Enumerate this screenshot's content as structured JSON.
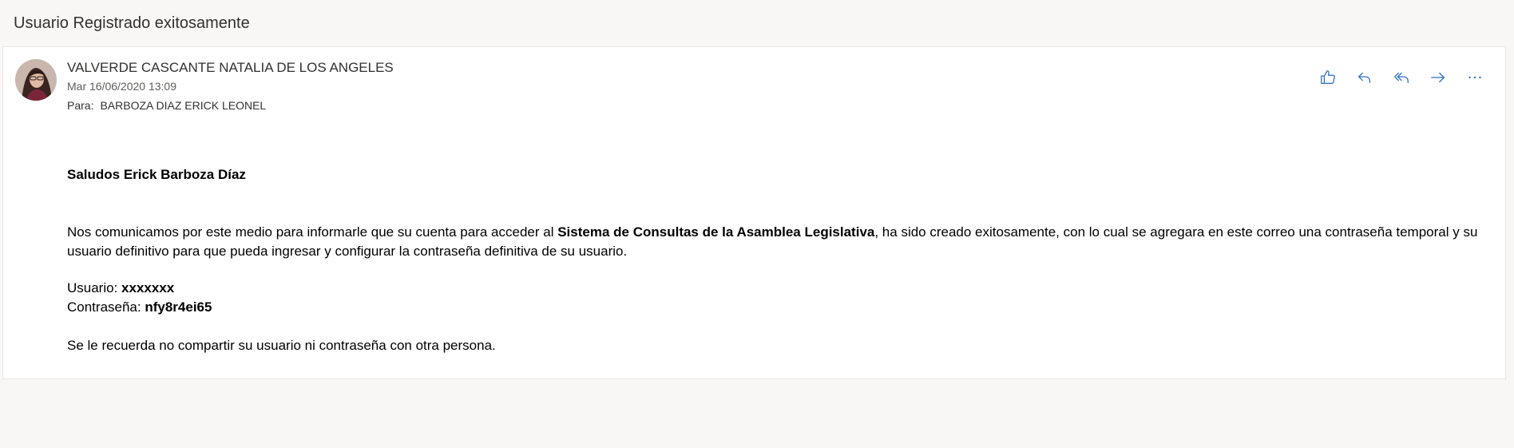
{
  "message": {
    "subject": "Usuario Registrado exitosamente",
    "sender": "VALVERDE CASCANTE NATALIA DE LOS ANGELES",
    "date": "Mar 16/06/2020 13:09",
    "to_label": "Para:",
    "to_value": "BARBOZA DIAZ ERICK LEONEL"
  },
  "actions": [
    {
      "icon": "thumbs-up-icon"
    },
    {
      "icon": "reply-icon"
    },
    {
      "icon": "reply-all-icon"
    },
    {
      "icon": "forward-icon"
    },
    {
      "icon": "more-icon"
    }
  ],
  "body": {
    "greeting": "Saludos Erick Barboza Díaz",
    "para_pre": "Nos comunicamos por este medio para informarle que su cuenta para acceder al ",
    "para_bold": "Sistema de Consultas de la Asamblea Legislativa",
    "para_post": ", ha sido creado exitosamente, con lo cual se agregara en este correo una contraseña temporal y su usuario definitivo para que pueda ingresar y configurar la contraseña definitiva de su usuario.",
    "user_label": "Usuario: ",
    "user_value": "xxxxxxx",
    "pass_label": "Contraseña: ",
    "pass_value": "nfy8r4ei65",
    "reminder": "Se le recuerda no compartir su usuario ni contraseña con otra persona."
  },
  "colors": {
    "accent": "#2b6fc2",
    "background": "#f8f7f6",
    "card": "#ffffff"
  }
}
